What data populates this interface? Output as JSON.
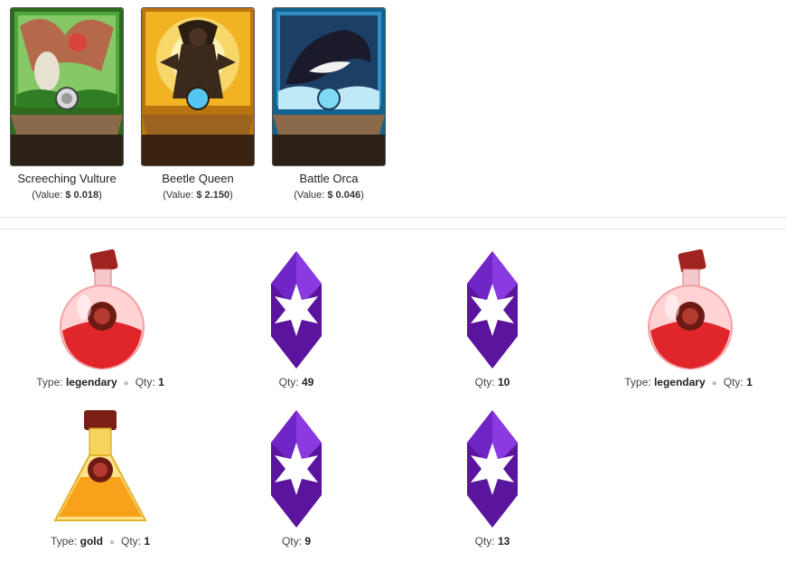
{
  "cards": [
    {
      "name": "Screeching Vulture",
      "value_prefix": "(Value: ",
      "value": "$ 0.018",
      "value_suffix": ")",
      "frame_color": "#3f8f2a",
      "icon": "vulture-card-art"
    },
    {
      "name": "Beetle Queen",
      "value_prefix": "(Value: ",
      "value": "$ 2.150",
      "value_suffix": ")",
      "frame_color": "#e0a01a",
      "icon": "beetle-queen-card-art"
    },
    {
      "name": "Battle Orca",
      "value_prefix": "(Value: ",
      "value": "$ 0.046",
      "value_suffix": ")",
      "frame_color": "#1b8fc4",
      "icon": "orca-card-art"
    }
  ],
  "items": [
    {
      "icon": "legendary-potion-icon",
      "type_label": "Type:",
      "type": "legendary",
      "qty_label": "Qty:",
      "qty": "1"
    },
    {
      "icon": "merit-crystal-icon",
      "qty_label": "Qty:",
      "qty": "49"
    },
    {
      "icon": "merit-crystal-icon",
      "qty_label": "Qty:",
      "qty": "10"
    },
    {
      "icon": "legendary-potion-icon",
      "type_label": "Type:",
      "type": "legendary",
      "qty_label": "Qty:",
      "qty": "1"
    },
    {
      "icon": "gold-potion-icon",
      "type_label": "Type:",
      "type": "gold",
      "qty_label": "Qty:",
      "qty": "1"
    },
    {
      "icon": "merit-crystal-icon",
      "qty_label": "Qty:",
      "qty": "9"
    },
    {
      "icon": "merit-crystal-icon",
      "qty_label": "Qty:",
      "qty": "13"
    }
  ],
  "colors": {
    "legendary_red": "#e0262b",
    "gold_orange": "#f7a21a",
    "crystal_purple": "#6a18b8"
  }
}
